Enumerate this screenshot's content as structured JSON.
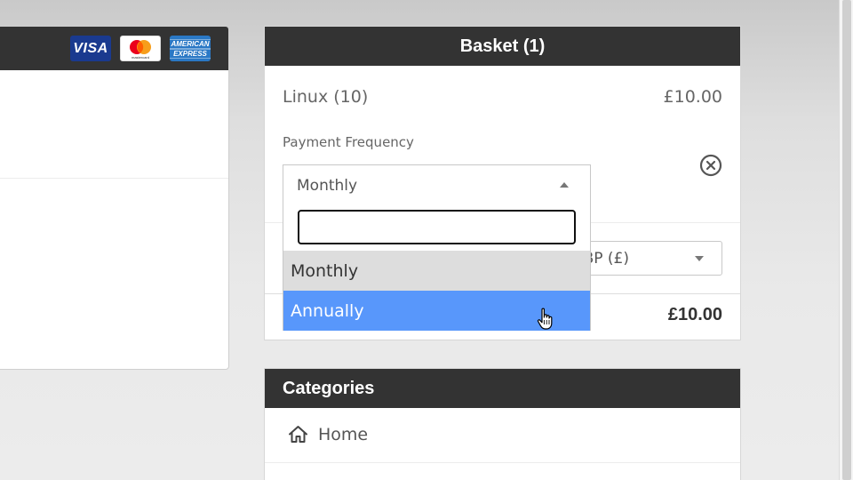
{
  "payment_cards": {
    "visa": "VISA",
    "mastercard": "mastercard",
    "amex_line1": "AMERICAN",
    "amex_line2": "EXPRESS"
  },
  "basket": {
    "title": "Basket (1)",
    "item": {
      "name": "Linux (10)",
      "price": "£10.00"
    },
    "frequency_label": "Payment Frequency",
    "frequency_selected": "Monthly",
    "currency_visible": "BP (£)",
    "total": "£10.00"
  },
  "dropdown": {
    "search_value": "",
    "options": [
      {
        "label": "Monthly",
        "state": "selected"
      },
      {
        "label": "Annually",
        "state": "highlighted"
      }
    ]
  },
  "categories": {
    "title": "Categories",
    "items": [
      {
        "label": "Home",
        "icon": "home-icon"
      }
    ]
  },
  "colors": {
    "header_bg": "#333333",
    "highlight": "#5897fb",
    "selected_option": "#dddddd"
  }
}
